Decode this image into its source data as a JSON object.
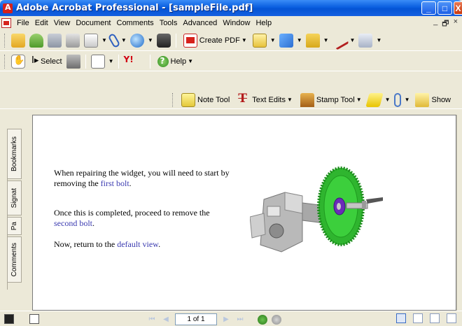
{
  "window": {
    "title": "Adobe Acrobat Professional - [sampleFile.pdf]",
    "controls": [
      "_",
      "□",
      "X"
    ]
  },
  "menu": {
    "items": [
      "File",
      "Edit",
      "View",
      "Document",
      "Comments",
      "Tools",
      "Advanced",
      "Window",
      "Help"
    ],
    "right_controls": [
      "_",
      "🗗",
      "×"
    ]
  },
  "toolbar1": {
    "create_pdf_label": "Create PDF"
  },
  "toolbar2": {
    "select_label": "Select",
    "yahoo_label": "Y!",
    "help_label": "Help"
  },
  "toolbar3": {
    "note_tool_label": "Note Tool",
    "text_edits_label": "Text Edits",
    "stamp_tool_label": "Stamp Tool",
    "show_label": "Show"
  },
  "nav_tabs": {
    "bookmarks": "Bookmarks",
    "signatures": "Signat",
    "pages": "Pa",
    "comments": "Comments"
  },
  "document": {
    "p1_before": "When repairing the widget, you will need to start by removing the ",
    "p1_link": "first bolt",
    "p1_after": ".",
    "p2_before": "Once this is completed, proceed to remove the ",
    "p2_link": "second bolt",
    "p2_after": ".",
    "p3_before": "Now, return to the ",
    "p3_link": "default view",
    "p3_after": "."
  },
  "status": {
    "page_field": "1 of 1"
  },
  "colors": {
    "link": "#3a3ab0",
    "gear": "#2fb52f",
    "titlebar": "#0a5fe0"
  }
}
